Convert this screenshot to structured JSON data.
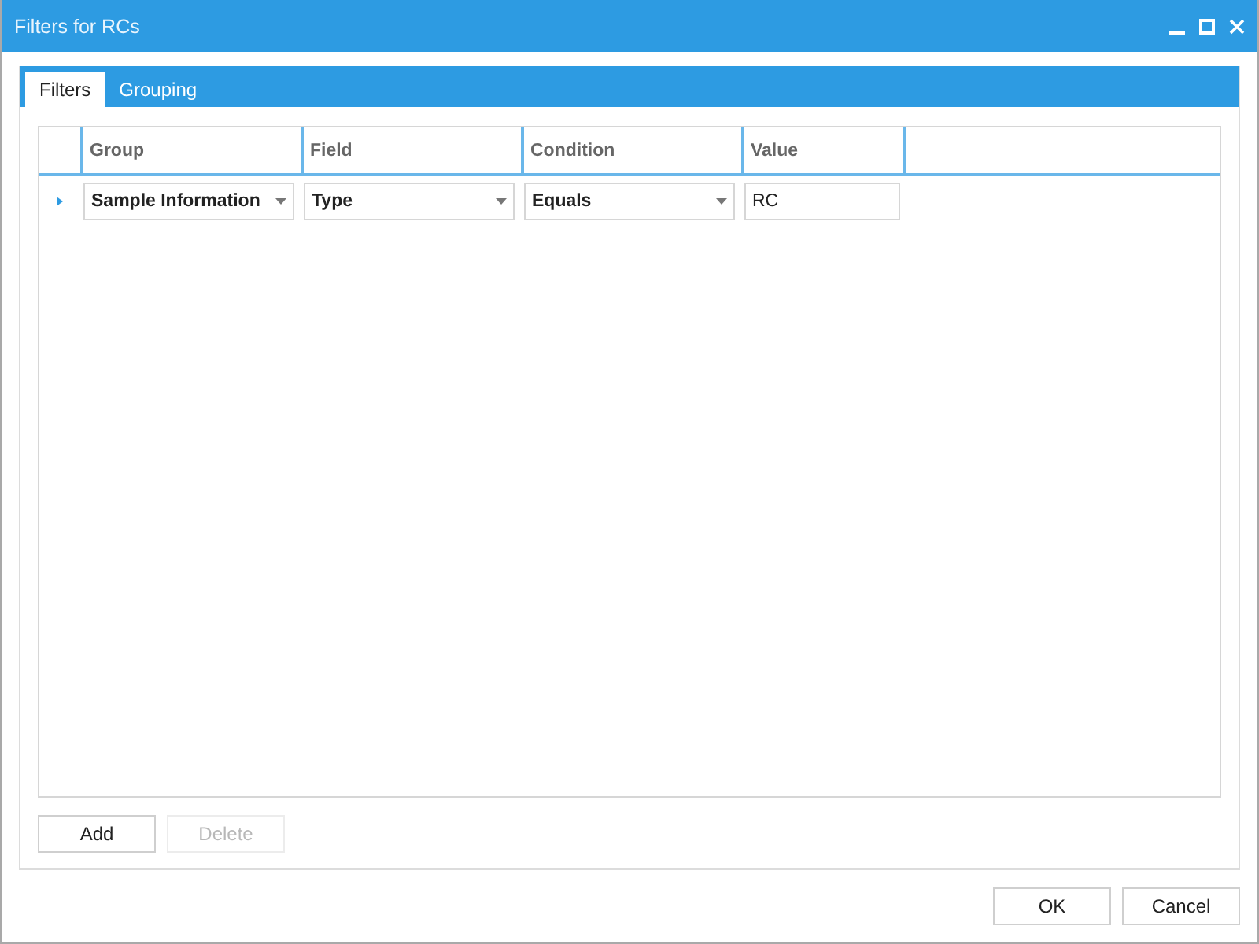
{
  "window": {
    "title": "Filters for RCs"
  },
  "tabs": [
    {
      "label": "Filters",
      "selected": true
    },
    {
      "label": "Grouping",
      "selected": false
    }
  ],
  "table": {
    "columns": [
      "Group",
      "Field",
      "Condition",
      "Value"
    ],
    "rows": [
      {
        "current": true,
        "group": "Sample Information",
        "field": "Type",
        "condition": "Equals",
        "value": "RC"
      }
    ]
  },
  "grid_buttons": [
    {
      "label": "Add",
      "disabled": false
    },
    {
      "label": "Delete",
      "disabled": true
    }
  ],
  "buttons": [
    "OK",
    "Cancel"
  ]
}
